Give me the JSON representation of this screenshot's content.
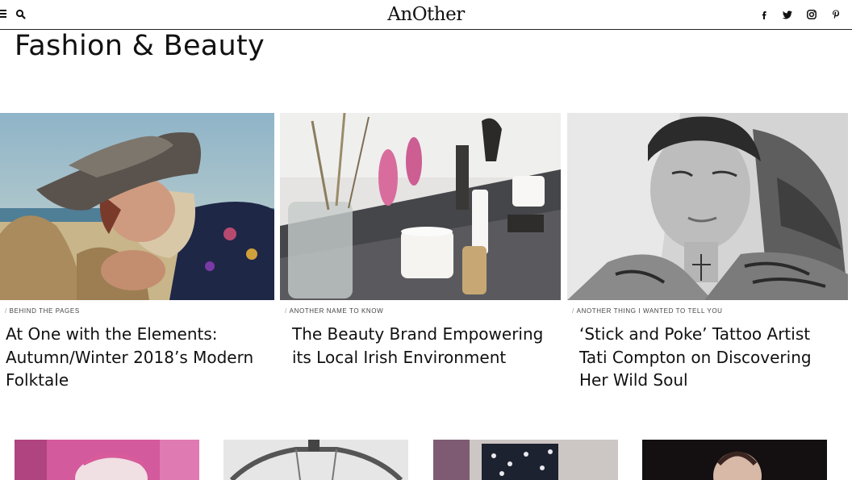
{
  "header": {
    "logo": "AnOther",
    "menu_icon": "hamburger-menu-icon",
    "search_icon": "search-icon",
    "social_icons": [
      "facebook-icon",
      "twitter-icon",
      "instagram-icon",
      "pinterest-icon"
    ]
  },
  "page": {
    "title": "Fashion & Beauty"
  },
  "articles": [
    {
      "category": "Behind the Pages",
      "title": "At One with the Elements: Autumn/Winter 2018’s Modern Folktale"
    },
    {
      "category": "Another Name to Know",
      "title": "The Beauty Brand Empowering its Local Irish Environment"
    },
    {
      "category": "Another Thing I Wanted to Tell You",
      "title": "‘Stick and Poke’ Tattoo Artist Tati Compton on Discovering Her Wild Soul"
    }
  ],
  "colors": {
    "text": "#111111",
    "divider": "#222222",
    "background": "#ffffff"
  }
}
